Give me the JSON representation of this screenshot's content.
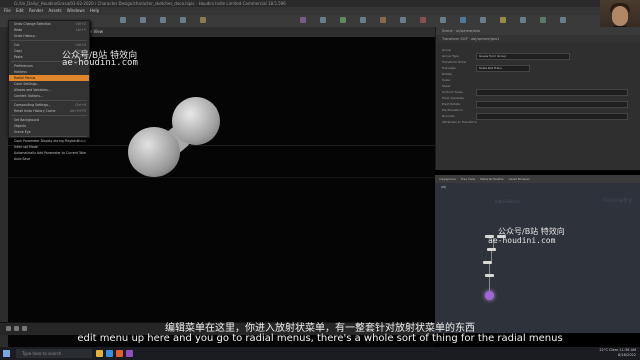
{
  "window": {
    "title": "G:/Ue_Daily/_Houdini/Grasa/03-02-2020 / Character Design/character_sketches_deco.hiplc - Houdini Indie Limited-Commercial 18.5.596"
  },
  "menubar": {
    "items": [
      "File",
      "Edit",
      "Render",
      "Assets",
      "Windows",
      "Help"
    ]
  },
  "edit_menu": {
    "items": [
      {
        "label": "Undo Change Selection",
        "shortcut": "Ctrl+Z"
      },
      {
        "label": "Redo",
        "shortcut": "Ctrl+Y"
      },
      {
        "label": "Undo History...",
        "shortcut": ""
      },
      {
        "label": "Cut",
        "shortcut": "Ctrl+X"
      },
      {
        "label": "Copy",
        "shortcut": "Ctrl+C"
      },
      {
        "label": "Paste",
        "shortcut": "Ctrl+V"
      },
      {
        "label": "Preferences",
        "shortcut": ""
      },
      {
        "label": "Hotkeys",
        "shortcut": ""
      },
      {
        "label": "Radial Menus",
        "shortcut": "",
        "selected": true
      },
      {
        "label": "Color Settings...",
        "shortcut": ""
      },
      {
        "label": "Aliases and Variables...",
        "shortcut": ""
      },
      {
        "label": "Content Options...",
        "shortcut": ""
      },
      {
        "label": "Compositing Settings...",
        "shortcut": "Ctrl+H"
      },
      {
        "label": "Reset Undo History Cache",
        "shortcut": "Alt+H+F5"
      },
      {
        "label": "Set Background",
        "shortcut": ""
      },
      {
        "label": "Objects",
        "shortcut": ""
      },
      {
        "label": "Scene Eye",
        "shortcut": ""
      },
      {
        "label": "Cook Parameter Display during Playback",
        "shortcut": "Stack"
      },
      {
        "label": "Interrupt Mode",
        "shortcut": ""
      },
      {
        "label": "Automatically Add Parameter to Current Take",
        "shortcut": ""
      },
      {
        "label": "Auto Save",
        "shortcut": ""
      }
    ]
  },
  "viewport": {
    "tab_label": "Scene View"
  },
  "watermark": {
    "top_line1": "公众号/B站 特效向",
    "top_line2": "ae-houdini.com",
    "bottom_line1": "公众号/B站 特效向",
    "bottom_line2": "ae-houdini.com"
  },
  "parameter_panel": {
    "tab_label": "Scene · ui/sphere/size",
    "header": "Transform SOP · obj/sphere/geo1",
    "rows": [
      "Group",
      "Group Type",
      "Transform Order",
      "Translate",
      "Rotate",
      "Scale",
      "Shear",
      "Uniform Scale",
      "Pivot Translate",
      "Pivot Rotate",
      "Pre-Transform",
      "Normals",
      "Attributes to Transform"
    ],
    "group_type_value": "Guess from Group",
    "transform_order_value": "Scale Rot Trans"
  },
  "network": {
    "tabs": [
      "/obj/sphere",
      "Tree View",
      "Material Palette",
      "Asset Browser"
    ],
    "path_label": "obj",
    "context_label": "Geometry",
    "menu_label": "Indie Edition"
  },
  "subtitles": {
    "zh": "编辑菜单在这里，你进入放射状菜单，有一整套针对放射状菜单的东西",
    "en": "edit menu up here and you go to radial menus, there's a whole sort of thing for the radial menus"
  },
  "taskbar": {
    "search_placeholder": "Type here to search",
    "weather": "22°C Clear",
    "time": "11:38 AM",
    "date": "8/16/2022"
  },
  "colors": {
    "menu_highlight": "#e0862a",
    "network_bg": "#2e323a",
    "node_selected": "#a266d8"
  }
}
